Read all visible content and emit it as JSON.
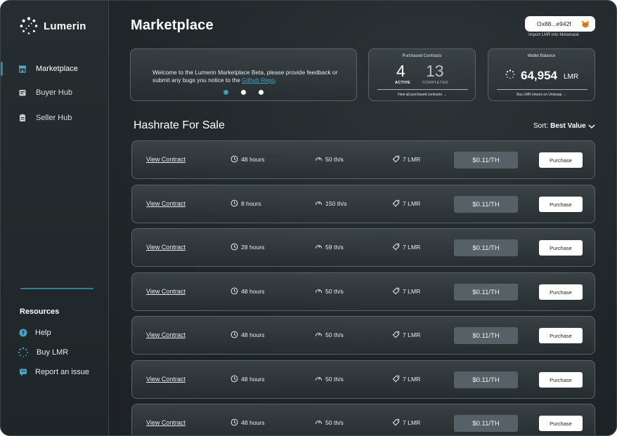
{
  "app": {
    "name": "Lumerin"
  },
  "sidebar": {
    "items": [
      {
        "label": "Marketplace",
        "icon": "store-icon",
        "active": true
      },
      {
        "label": "Buyer Hub",
        "icon": "buyer-hub-icon",
        "active": false
      },
      {
        "label": "Seller Hub",
        "icon": "seller-hub-icon",
        "active": false
      }
    ],
    "resources_title": "Resources",
    "resources": [
      {
        "label": "Help",
        "icon": "help-icon"
      },
      {
        "label": "Buy LMR",
        "icon": "lumerin-logo-icon"
      },
      {
        "label": "Report an issue",
        "icon": "report-icon"
      }
    ]
  },
  "header": {
    "title": "Marketplace",
    "wallet_address": "Ox88...e942f",
    "import_link": "Import LMR into Metamask"
  },
  "welcome": {
    "text": "Welcome to the Lumerin Marketplace Beta, please provide feedback or submit any bugs you notice to the ",
    "link": "Github Repo",
    "tail": ".",
    "dots": 3,
    "active_dot": 0
  },
  "purchased": {
    "header": "Purchased Contracts",
    "active_count": "4",
    "active_label": "ACTIVE",
    "completed_count": "13",
    "completed_label": "COMPLETED",
    "link": "View all purchased contracts →"
  },
  "wallet": {
    "header": "Wallet Balance",
    "amount": "64,954",
    "unit": "LMR",
    "link": "Buy LMR tokens on Uniswap →"
  },
  "section": {
    "title": "Hashrate For Sale",
    "sort_label": "Sort:",
    "sort_value": "Best Value"
  },
  "colors": {
    "accent": "#2a87a8",
    "link": "#3fa2c4",
    "price_bg": "#556166"
  },
  "rows": [
    {
      "view": "View Contract",
      "duration": "48 hours",
      "speed": "50 th/s",
      "price_lmr": "7 LMR",
      "price_th": "$0.11/TH",
      "action": "Purchase"
    },
    {
      "view": "View Contract",
      "duration": "8 hours",
      "speed": "150 th/s",
      "price_lmr": "7 LMR",
      "price_th": "$0.11/TH",
      "action": "Purchase"
    },
    {
      "view": "View Contract",
      "duration": "28 hours",
      "speed": "59 th/s",
      "price_lmr": "7 LMR",
      "price_th": "$0.11/TH",
      "action": "Purchase"
    },
    {
      "view": "View Contract",
      "duration": "48 hours",
      "speed": "50 th/s",
      "price_lmr": "7 LMR",
      "price_th": "$0.11/TH",
      "action": "Purchase"
    },
    {
      "view": "View Contract",
      "duration": "48 hours",
      "speed": "50 th/s",
      "price_lmr": "7 LMR",
      "price_th": "$0.11/TH",
      "action": "Purchase"
    },
    {
      "view": "View Contract",
      "duration": "48 hours",
      "speed": "50 th/s",
      "price_lmr": "7 LMR",
      "price_th": "$0.11/TH",
      "action": "Purchase"
    },
    {
      "view": "View Contract",
      "duration": "48 hours",
      "speed": "50 th/s",
      "price_lmr": "7 LMR",
      "price_th": "$0.11/TH",
      "action": "Purchase"
    }
  ]
}
